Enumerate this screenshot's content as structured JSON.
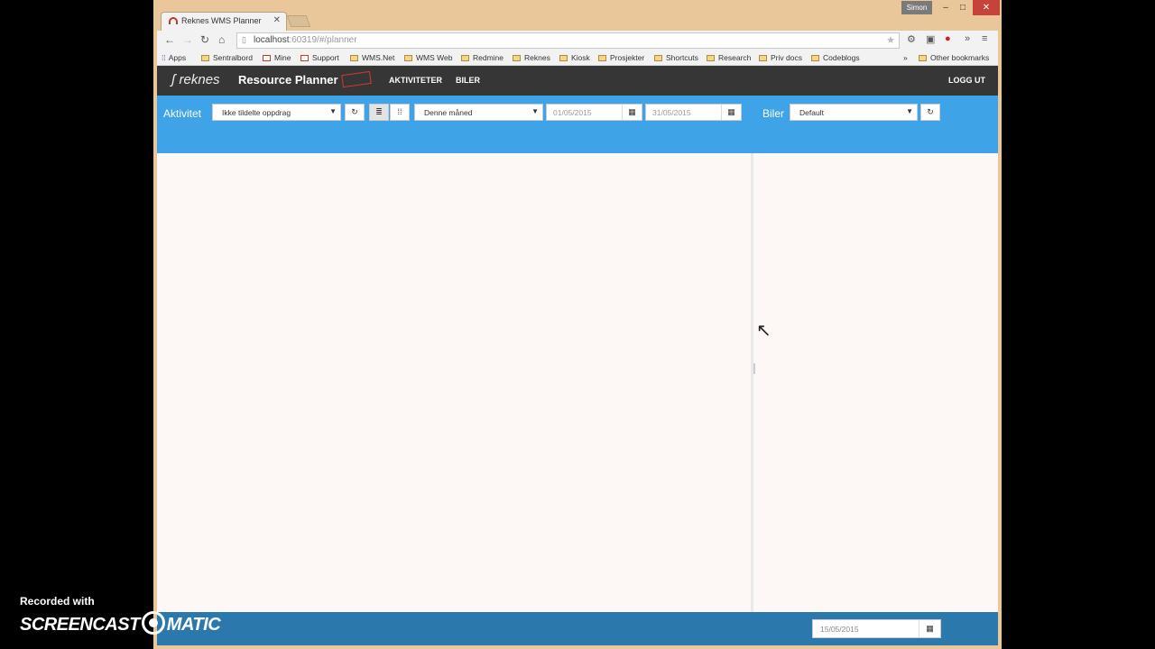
{
  "browser": {
    "tab_title": "Reknes WMS Planner",
    "profile_name": "Simon",
    "url_host": "localhost",
    "url_rest": ":60319/#/planner",
    "bookmarks": [
      {
        "label": "Apps"
      },
      {
        "label": "Sentralbord"
      },
      {
        "label": "Mine"
      },
      {
        "label": "Support"
      },
      {
        "label": "WMS.Net"
      },
      {
        "label": "WMS Web"
      },
      {
        "label": "Redmine"
      },
      {
        "label": "Reknes"
      },
      {
        "label": "Kiosk"
      },
      {
        "label": "Prosjekter"
      },
      {
        "label": "Shortcuts"
      },
      {
        "label": "Research"
      },
      {
        "label": "Priv docs"
      },
      {
        "label": "Codeblogs"
      }
    ],
    "bookmarks_overflow": "»",
    "other_bookmarks": "Other bookmarks"
  },
  "app": {
    "logo_text": "reknes",
    "title": "Resource Planner",
    "nav": {
      "activities": "AKTIVITETER",
      "cars": "BILER",
      "logout": "LOGG UT"
    },
    "filter": {
      "activity_label": "Aktivitet",
      "activity_select": "Ikke tildelte oppdrag",
      "period_select": "Denne måned",
      "from_date": "01/05/2015",
      "to_date": "31/05/2015",
      "cars_label": "Biler",
      "cars_select": "Default"
    },
    "footer": {
      "date": "15/05/2015"
    }
  },
  "watermark": {
    "line1": "Recorded with",
    "brand_left": "SCREENCAST",
    "brand_right": "MATIC"
  }
}
